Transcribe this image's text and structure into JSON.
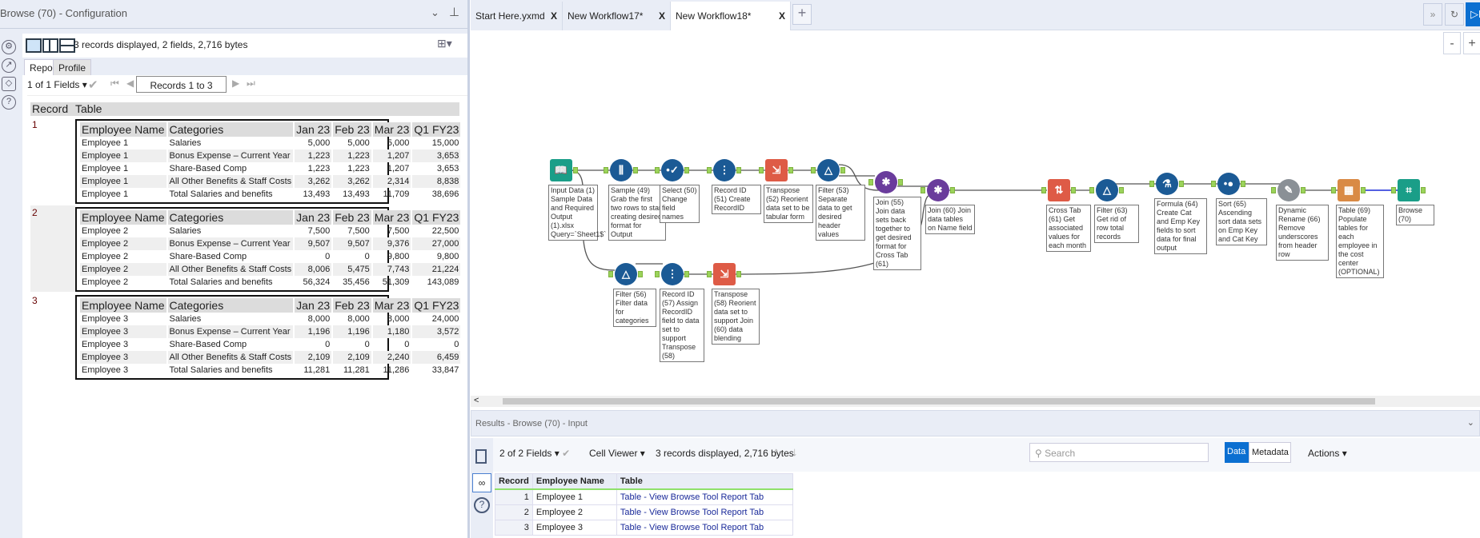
{
  "left_panel": {
    "title": "Browse (70) - Configuration",
    "status": "3 records displayed, 2 fields, 2,716 bytes",
    "tabs": [
      "Report",
      "Profile"
    ],
    "fields_selector": "1 of 1 Fields",
    "records_range": "Records 1 to 3",
    "side_icons": [
      "gear-icon",
      "arrow-circle-icon",
      "tag-icon",
      "question-icon"
    ],
    "report": {
      "headers": [
        "Record",
        "Table"
      ],
      "inner_headers": [
        "Employee Name",
        "Categories",
        "Jan 23",
        "Feb 23",
        "Mar 23",
        "Q1 FY23"
      ],
      "records": [
        {
          "num": "1",
          "rows": [
            [
              "Employee 1",
              "Salaries",
              "5,000",
              "5,000",
              "5,000",
              "15,000"
            ],
            [
              "Employee 1",
              "Bonus Expense – Current Year",
              "1,223",
              "1,223",
              "1,207",
              "3,653"
            ],
            [
              "Employee 1",
              "Share-Based Comp",
              "1,223",
              "1,223",
              "1,207",
              "3,653"
            ],
            [
              "Employee 1",
              "All Other Benefits & Staff Costs",
              "3,262",
              "3,262",
              "2,314",
              "8,838"
            ],
            [
              "Employee 1",
              "Total Salaries and benefits",
              "13,493",
              "13,493",
              "11,709",
              "38,696"
            ]
          ]
        },
        {
          "num": "2",
          "rows": [
            [
              "Employee 2",
              "Salaries",
              "7,500",
              "7,500",
              "7,500",
              "22,500"
            ],
            [
              "Employee 2",
              "Bonus Expense – Current Year",
              "9,507",
              "9,507",
              "9,376",
              "27,000"
            ],
            [
              "Employee 2",
              "Share-Based Comp",
              "0",
              "0",
              "9,800",
              "9,800"
            ],
            [
              "Employee 2",
              "All Other Benefits & Staff Costs",
              "8,006",
              "5,475",
              "7,743",
              "21,224"
            ],
            [
              "Employee 2",
              "Total Salaries and benefits",
              "56,324",
              "35,456",
              "51,309",
              "143,089"
            ]
          ]
        },
        {
          "num": "3",
          "rows": [
            [
              "Employee 3",
              "Salaries",
              "8,000",
              "8,000",
              "8,000",
              "24,000"
            ],
            [
              "Employee 3",
              "Bonus Expense – Current Year",
              "1,196",
              "1,196",
              "1,180",
              "3,572"
            ],
            [
              "Employee 3",
              "Share-Based Comp",
              "0",
              "0",
              "0",
              "0"
            ],
            [
              "Employee 3",
              "All Other Benefits & Staff Costs",
              "2,109",
              "2,109",
              "2,240",
              "6,459"
            ],
            [
              "Employee 3",
              "Total Salaries and benefits",
              "11,281",
              "11,281",
              "11,286",
              "33,847"
            ]
          ]
        }
      ]
    }
  },
  "workflow_tabs": [
    {
      "label": "Start Here.yxmd",
      "active": false
    },
    {
      "label": "New Workflow17*",
      "active": false
    },
    {
      "label": "New Workflow18*",
      "active": true
    }
  ],
  "close_glyph": "X",
  "add_tab": "+",
  "run_label": "R",
  "zoom": {
    "minus": "-",
    "plus": "+"
  },
  "colors": {
    "accent": "#0b6fd1",
    "connector": "#9bd35a",
    "teal": "#1a9e88",
    "blue": "#1b5a95",
    "red": "#de5b46",
    "purple": "#6a3c9c",
    "orange": "#d98a45"
  },
  "nodes": [
    {
      "id": "input-1",
      "icon": "book-icon",
      "glyph": "📖",
      "color": "#1a9e88",
      "annotation": "Input Data (1) Sample Data and Required Output (1).xlsx Query=`Sheet1$`"
    },
    {
      "id": "sample-49",
      "icon": "sample-icon",
      "glyph": "⫼",
      "color": "#1b5a95",
      "annotation": "Sample (49) Grab the first two rows to start creating desired format for Output"
    },
    {
      "id": "select-50",
      "icon": "select-check-icon",
      "glyph": "•✓",
      "color": "#1b5a95",
      "annotation": "Select (50) Change field names"
    },
    {
      "id": "recordid-51",
      "icon": "record-id-icon",
      "glyph": "⋮",
      "color": "#1b5a95",
      "annotation": "Record ID (51) Create RecordID"
    },
    {
      "id": "transpose-52",
      "icon": "transpose-icon",
      "glyph": "⇲",
      "color": "#de5b46",
      "annotation": "Transpose (52) Reorient data set to be tabular form"
    },
    {
      "id": "filter-53",
      "icon": "filter-icon",
      "glyph": "△",
      "color": "#1b5a95",
      "annotation": "Filter (53) Separate data to get desired header values"
    },
    {
      "id": "join-55",
      "icon": "join-icon",
      "glyph": "✱",
      "color": "#6a3c9c",
      "annotation": "Join (55) Join data sets back together to get desired format for Cross Tab (61)"
    },
    {
      "id": "join-60",
      "icon": "join-icon",
      "glyph": "✱",
      "color": "#6a3c9c",
      "annotation": "Join (60) Join data tables on Name field"
    },
    {
      "id": "crosstab-61",
      "icon": "cross-tab-icon",
      "glyph": "⇅",
      "color": "#de5b46",
      "annotation": "Cross Tab (61) Get associated values for each month"
    },
    {
      "id": "filter-63",
      "icon": "filter-icon",
      "glyph": "△",
      "color": "#1b5a95",
      "annotation": "Filter (63) Get rid of row total records"
    },
    {
      "id": "formula-64",
      "icon": "formula-flask-icon",
      "glyph": "⚗",
      "color": "#1b5a95",
      "annotation": "Formula (64) Create Cat and Emp Key fields to sort data for final output"
    },
    {
      "id": "sort-65",
      "icon": "sort-icon",
      "glyph": "•●",
      "color": "#1b5a95",
      "annotation": "Sort (65) Ascending sort data sets on Emp Key and Cat Key"
    },
    {
      "id": "dynrename-66",
      "icon": "dynamic-rename-icon",
      "glyph": "✎",
      "color": "#8a9096",
      "annotation": "Dynamic Rename (66) Remove underscores from header row"
    },
    {
      "id": "table-69",
      "icon": "table-icon",
      "glyph": "▦",
      "color": "#d98a45",
      "annotation": "Table (69) Populate tables for each employee in the cost center (OPTIONAL)"
    },
    {
      "id": "browse-70",
      "icon": "binoculars-icon",
      "glyph": "⌗",
      "color": "#1a9e88",
      "annotation": "Browse (70)"
    },
    {
      "id": "filter-56",
      "icon": "filter-icon",
      "glyph": "△",
      "color": "#1b5a95",
      "annotation": "Filter (56) Filter data for categories"
    },
    {
      "id": "recordid-57",
      "icon": "record-id-icon",
      "glyph": "⋮",
      "color": "#1b5a95",
      "annotation": "Record ID (57) Assign RecordID field to data set to support Transpose (58)"
    },
    {
      "id": "transpose-58",
      "icon": "transpose-icon",
      "glyph": "⇲",
      "color": "#de5b46",
      "annotation": "Transpose (58) Reorient data set to support Join (60) data blending"
    }
  ],
  "results": {
    "title": "Results - Browse (70) - Input",
    "fields_selector": "2 of 2 Fields",
    "viewer": "Cell Viewer",
    "status": "3 records displayed, 2,716 bytes",
    "search_placeholder": "Search",
    "data_btn": "Data",
    "metadata_btn": "Metadata",
    "actions": "Actions",
    "columns": [
      "Record",
      "Employee Name",
      "Table"
    ],
    "rows": [
      [
        "1",
        "Employee 1",
        "Table - View Browse Tool Report Tab"
      ],
      [
        "2",
        "Employee 2",
        "Table - View Browse Tool Report Tab"
      ],
      [
        "3",
        "Employee 3",
        "Table - View Browse Tool Report Tab"
      ]
    ]
  }
}
